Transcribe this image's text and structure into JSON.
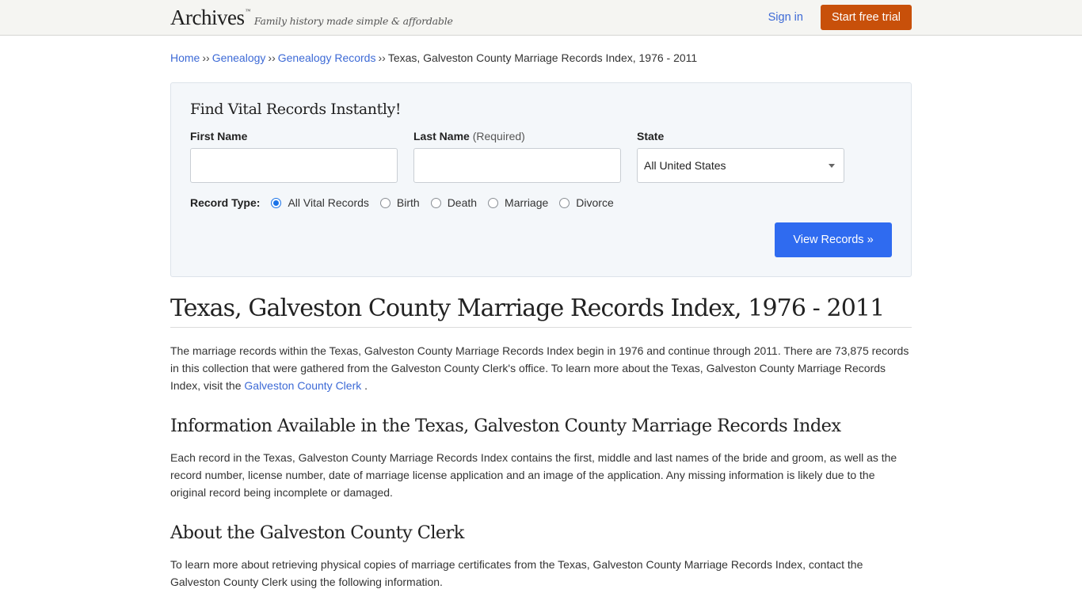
{
  "header": {
    "logo": "Archives",
    "logo_tm": "™",
    "tagline": "Family history made simple & affordable",
    "signin_label": "Sign in",
    "trial_label": "Start free trial"
  },
  "breadcrumb": {
    "items": [
      {
        "label": "Home"
      },
      {
        "label": "Genealogy"
      },
      {
        "label": "Genealogy Records"
      }
    ],
    "separator": "››",
    "current": "Texas, Galveston County Marriage Records Index, 1976 - 2011"
  },
  "search": {
    "title": "Find Vital Records Instantly!",
    "first_name": {
      "label": "First Name",
      "value": "",
      "placeholder": ""
    },
    "last_name": {
      "label": "Last Name",
      "required_note": "(Required)",
      "value": "",
      "placeholder": ""
    },
    "state": {
      "label": "State",
      "selected": "All United States"
    },
    "record_type": {
      "label": "Record Type:",
      "options": [
        {
          "label": "All Vital Records",
          "checked": true
        },
        {
          "label": "Birth",
          "checked": false
        },
        {
          "label": "Death",
          "checked": false
        },
        {
          "label": "Marriage",
          "checked": false
        },
        {
          "label": "Divorce",
          "checked": false
        }
      ]
    },
    "submit_label": "View Records »"
  },
  "article": {
    "title": "Texas, Galveston County Marriage Records Index, 1976 - 2011",
    "intro": {
      "text_before": "The marriage records within the Texas, Galveston County Marriage Records Index begin in 1976 and continue through 2011. There are 73,875 records in this collection that were gathered from the Galveston County Clerk's office. To learn more about the Texas, Galveston County Marriage Records Index, visit the ",
      "link": "Galveston County Clerk",
      "text_after": " ."
    },
    "sections": [
      {
        "title": "Information Available in the Texas, Galveston County Marriage Records Index",
        "body": "Each record in the Texas, Galveston County Marriage Records Index contains the first, middle and last names of the bride and groom, as well as the record number, license number, date of marriage license application and an image of the application. Any missing information is likely due to the original record being incomplete or damaged."
      },
      {
        "title": "About the Galveston County Clerk",
        "body": "To learn more about retrieving physical copies of marriage certificates from the Texas, Galveston County Marriage Records Index, contact the Galveston County Clerk using the following information."
      }
    ]
  },
  "colors": {
    "accent_link": "#3d6ad6",
    "trial_button": "#c8500a",
    "primary_button": "#2f6bf0",
    "header_bg": "#f5f5f2",
    "search_bg": "#f4f7fa"
  }
}
